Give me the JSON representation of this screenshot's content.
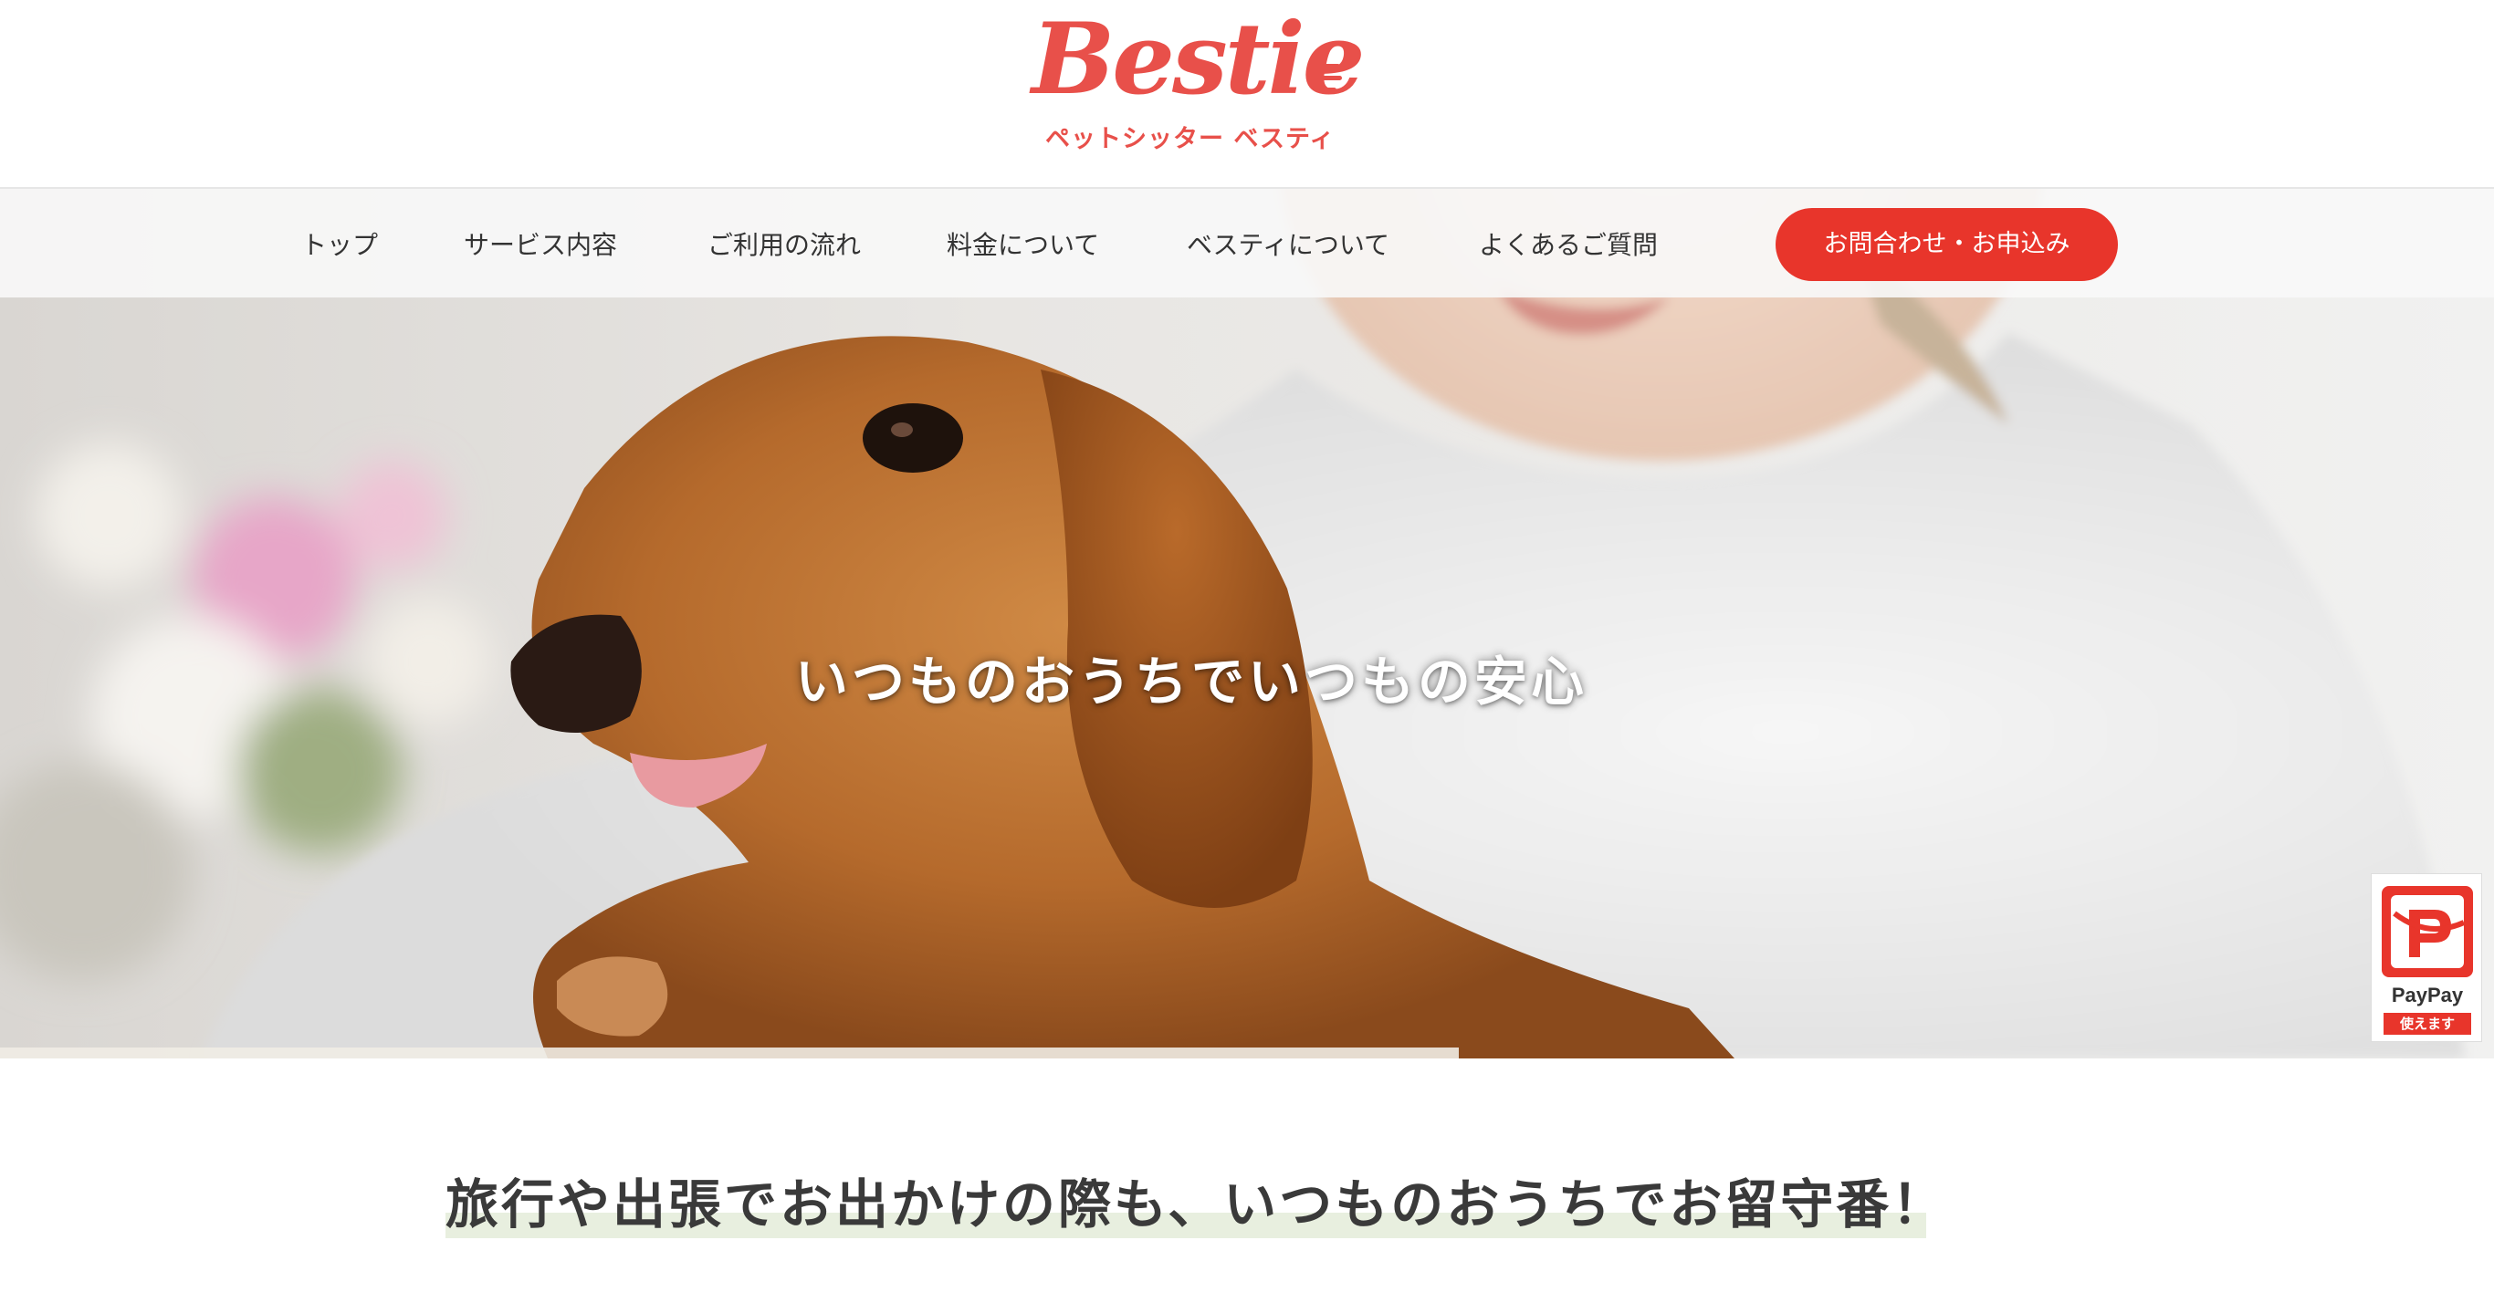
{
  "header": {
    "logo": {
      "wordmark": "Bestie",
      "subtitle": "ペットシッター ベスティ",
      "brand_color": "#e8504a"
    }
  },
  "nav": {
    "items": [
      {
        "label": "トップ"
      },
      {
        "label": "サービス内容"
      },
      {
        "label": "ご利用の流れ"
      },
      {
        "label": "料金について"
      },
      {
        "label": "ベスティについて"
      },
      {
        "label": "よくあるご質問"
      }
    ],
    "cta_label": "お問合わせ・お申込み",
    "cta_color": "#e8352b"
  },
  "hero": {
    "title": "いつものおうちでいつもの安心",
    "slide_progress": 0.585
  },
  "paypay": {
    "label": "PayPay",
    "tag": "使えます",
    "icon": "paypay-logo-icon"
  },
  "intro": {
    "heading": "旅行や出張でお出かけの際も、いつものおうちでお留守番！",
    "highlight_color": "#e8efdf"
  }
}
